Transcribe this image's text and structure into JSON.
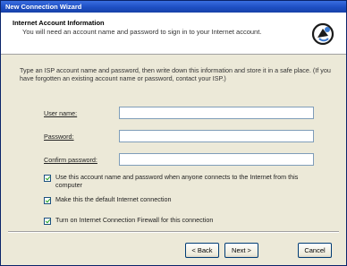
{
  "window": {
    "title": "New Connection Wizard"
  },
  "header": {
    "title": "Internet Account Information",
    "subtitle": "You will need an account name and password to sign in to your Internet account.",
    "icon": "network-wizard-icon"
  },
  "intro_text": "Type an ISP account name and password, then write down this information and store it in a safe place. (If you have forgotten an existing account name or password, contact your ISP.)",
  "fields": [
    {
      "label": "User name:",
      "value": ""
    },
    {
      "label": "Password:",
      "value": ""
    },
    {
      "label": "Confirm password:",
      "value": ""
    }
  ],
  "checkboxes": [
    {
      "label": "Use this account name and password when anyone connects to the Internet from this computer",
      "checked": true
    },
    {
      "label": "Make this the default Internet connection",
      "checked": true
    },
    {
      "label": "Turn on Internet Connection Firewall for this connection",
      "checked": true
    }
  ],
  "buttons": {
    "back": "< Back",
    "next": "Next >",
    "cancel": "Cancel"
  },
  "colors": {
    "titlebar": "#1e4fc4",
    "dialog_bg": "#ece9d8",
    "check": "#21a121"
  }
}
